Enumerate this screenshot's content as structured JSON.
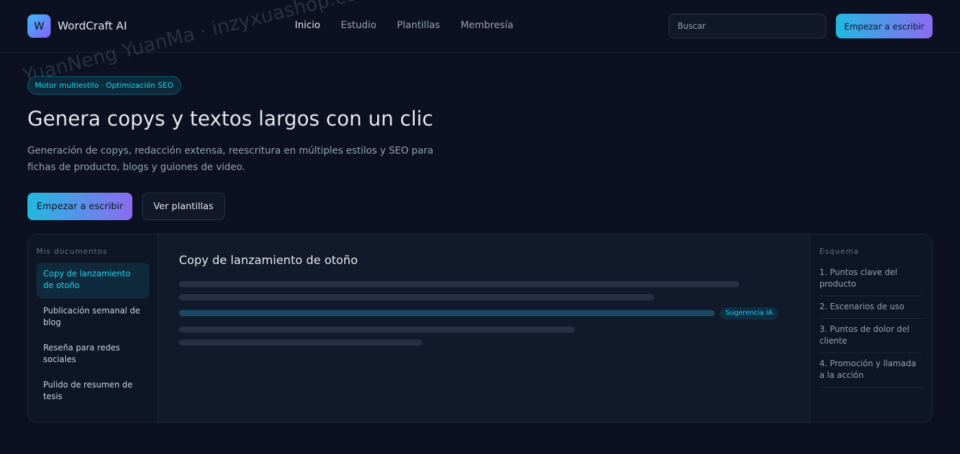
{
  "brand": {
    "logo_letter": "W",
    "name": "WordCraft AI"
  },
  "nav": {
    "items": [
      "Inicio",
      "Estudio",
      "Plantillas",
      "Membresía"
    ],
    "active_index": 0
  },
  "search": {
    "placeholder": "Buscar",
    "value": ""
  },
  "header_cta": "Empezar a escribir",
  "hero": {
    "badge": "Motor multiestilo · Optimización SEO",
    "title": "Genera copys y textos largos con un clic",
    "description": "Generación de copys, redacción extensa, reescritura en múltiples estilos y SEO para fichas de producto, blogs y guiones de video.",
    "primary_cta": "Empezar a escribir",
    "secondary_cta": "Ver plantillas"
  },
  "workspace": {
    "sidebar": {
      "label": "Mis documentos",
      "documents": [
        "Copy de lanzamiento de otoño",
        "Publicación semanal de blog",
        "Reseña para redes sociales",
        "Pulido de resumen de tesis"
      ],
      "active_index": 0
    },
    "editor": {
      "title": "Copy de lanzamiento de otoño",
      "ai_tag": "Sugerencia IA"
    },
    "outline": {
      "label": "Esquema",
      "items": [
        "1. Puntos clave del producto",
        "2. Escenarios de uso",
        "3. Puntos de dolor del cliente",
        "4. Promoción y llamada a la acción"
      ]
    }
  },
  "watermark": "YuanNeng YuanMa · inzyxuashop.com",
  "colors": {
    "accent_start": "#22b8e0",
    "accent_end": "#8b6cf0",
    "background": "#0b1120",
    "highlight": "#22d3ee"
  }
}
